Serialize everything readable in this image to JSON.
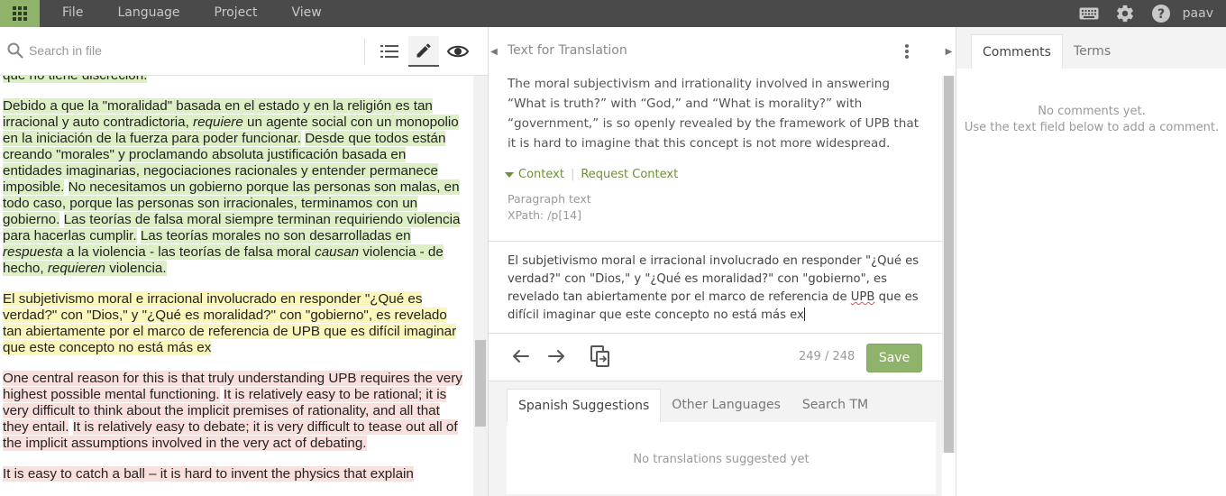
{
  "menu": {
    "items": [
      "File",
      "Language",
      "Project",
      "View"
    ],
    "user": "paav"
  },
  "left": {
    "search_placeholder": "Search in file",
    "paragraphs": [
      [
        {
          "t": "Debido a que la \"moralidad\" basada en el estado y en la religión es tan irracional y auto contradictoria, ",
          "c": "g"
        },
        {
          "t": "requiere",
          "c": "g",
          "i": true
        },
        {
          "t": " un agente social con un monopolio en la iniciación de la fuerza para poder funcionar.",
          "c": "g"
        },
        {
          "t": " ",
          "c": ""
        },
        {
          "t": "Desde que todos están creando \"morales\" y proclamando absoluta justificación basada en entidades imaginarias, negociaciones racionales y entender permanece imposible.",
          "c": "g"
        },
        {
          "t": " ",
          "c": ""
        },
        {
          "t": "No necesitamos un gobierno porque las personas son malas, en todo caso, porque las personas son irracionales, terminamos con un gobierno.",
          "c": "g"
        },
        {
          "t": " ",
          "c": ""
        },
        {
          "t": "Las teorías de falsa moral siempre terminan requiriendo violencia para hacerlas cumplir.",
          "c": "g"
        },
        {
          "t": " ",
          "c": ""
        },
        {
          "t": "Las teorías morales no son desarrolladas en ",
          "c": "g"
        },
        {
          "t": "respuesta",
          "c": "g",
          "i": true
        },
        {
          "t": " a la violencia - las teorías de falsa moral ",
          "c": "g"
        },
        {
          "t": "causan",
          "c": "g",
          "i": true
        },
        {
          "t": " violencia - de hecho, ",
          "c": "g"
        },
        {
          "t": "requieren",
          "c": "g",
          "i": true
        },
        {
          "t": " violencia.",
          "c": "g"
        }
      ],
      [
        {
          "t": "El subjetivismo moral e irracional involucrado en responder \"¿Qué es verdad?\" con \"Dios,\" y \"¿Qué es moralidad?\" con \"gobierno\", es revelado tan abiertamente por el marco de referencia de UPB que es difícil imaginar que este concepto no está más ex",
          "c": "y"
        }
      ],
      [
        {
          "t": "One central reason for this is that truly understanding UPB requires the very highest possible mental functioning.",
          "c": "r"
        },
        {
          "t": " ",
          "c": ""
        },
        {
          "t": "It is relatively easy to be rational; it is very difficult to think about the implicit premises of rationality, and all that they entail.",
          "c": "r"
        },
        {
          "t": " ",
          "c": ""
        },
        {
          "t": "It is relatively easy to debate; it is very difficult to tease out all of the implicit assumptions involved in the very act of debating.",
          "c": "r"
        }
      ],
      [
        {
          "t": "It is easy to catch a ball – it is hard to invent the physics that explain",
          "c": "r"
        }
      ]
    ]
  },
  "middle": {
    "source_title": "Text for Translation",
    "source_text": "The moral subjectivism and irrationality involved in answering “What is truth?” with “God,” and “What is morality?” with “government,” is so openly revealed by the framework of UPB that it is hard to imagine that this concept is not more widespread.",
    "context_label": "Context",
    "request_context": "Request Context",
    "meta_type": "Paragraph text",
    "meta_xpath": "XPath: /p[14]",
    "target_before": "El subjetivismo moral e irracional involucrado en responder \"¿Qué es verdad?\" con \"Dios,\" y \"¿Qué es moralidad?\" con \"gobierno\", es revelado tan abiertamente por el marco de referencia de ",
    "target_spell": "UPB",
    "target_after": " que es difícil imaginar que este concepto no está más ex",
    "counter": "249 / 248",
    "save_label": "Save",
    "sugg_tabs": [
      "Spanish Suggestions",
      "Other Languages",
      "Search TM"
    ],
    "no_suggestions": "No translations suggested yet"
  },
  "right": {
    "tabs": [
      "Comments",
      "Terms"
    ],
    "no_comments": "No comments yet.",
    "no_comments_hint": "Use the text field below to add a comment."
  },
  "colors": {
    "accent": "#8fb36a",
    "translated": "#ddefc5",
    "current": "#fbf7ba",
    "untranslated": "#f9e0dd"
  }
}
